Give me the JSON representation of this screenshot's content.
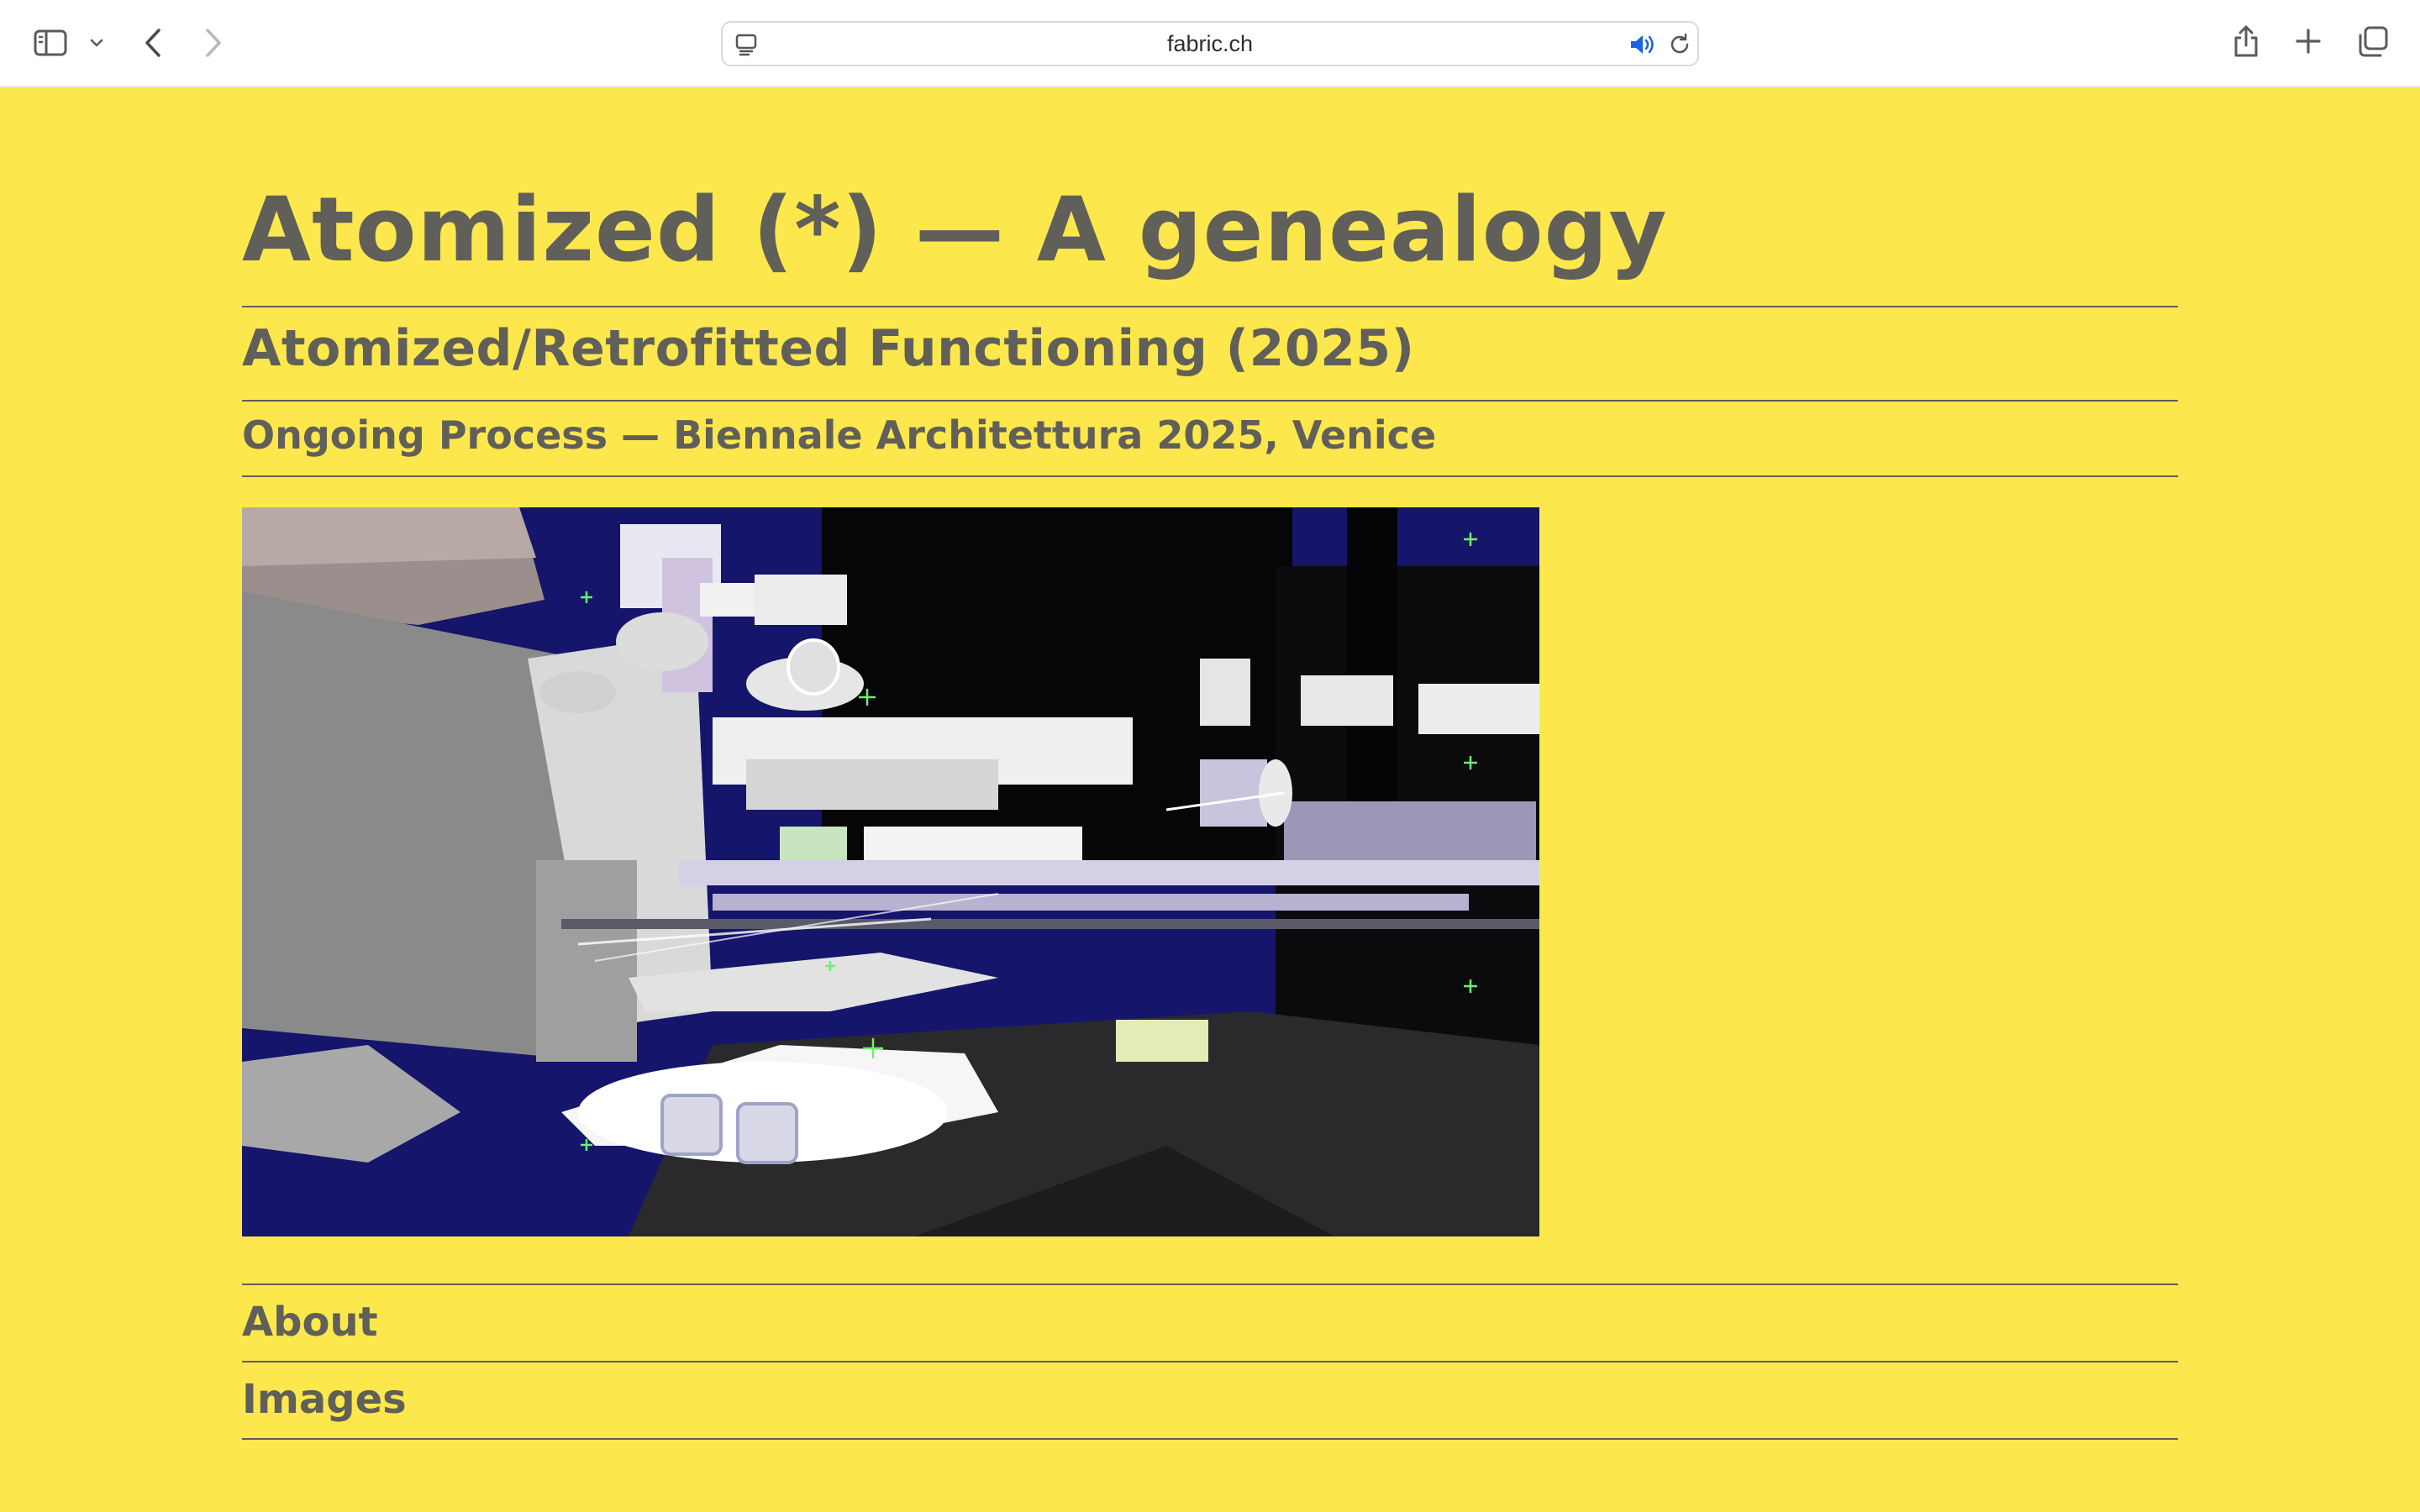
{
  "browser": {
    "url": "fabric.ch",
    "icons": [
      "sidebar-icon",
      "chevron-down-icon",
      "back-icon",
      "forward-icon",
      "site-settings-icon",
      "audio-playing-icon",
      "reload-icon",
      "share-icon",
      "new-tab-icon",
      "tab-overview-icon"
    ],
    "accent_color": "#1a63e0"
  },
  "page": {
    "title": "Atomized (*) — A genealogy",
    "subtitle": "Atomized/Retrofitted Functioning (2025)",
    "tagline": "Ongoing Process — Biennale Architettura 2025, Venice",
    "nav": [
      {
        "label": "About"
      },
      {
        "label": "Images"
      }
    ],
    "background_color": "#fce84c",
    "text_color": "#615f5a"
  }
}
